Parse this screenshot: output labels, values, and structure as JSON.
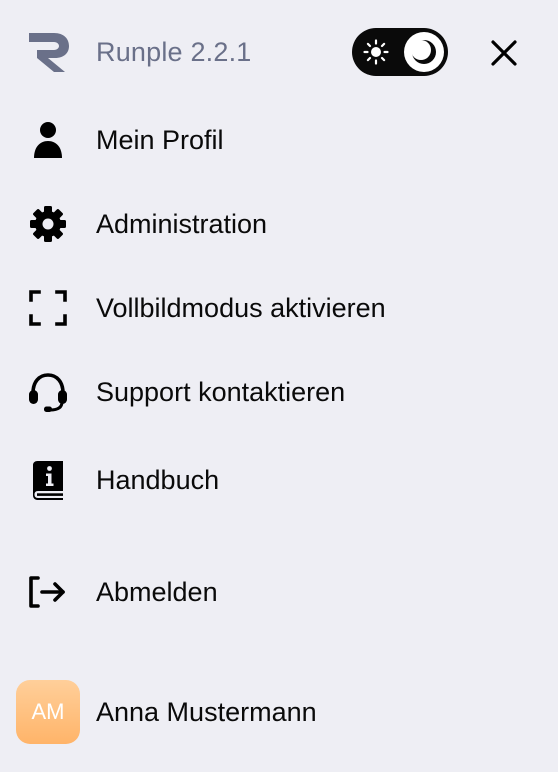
{
  "header": {
    "app_title": "Runple 2.2.1",
    "theme_toggle": {
      "light_icon": "sun-icon",
      "dark_icon": "moon-icon",
      "active": "dark"
    },
    "close_icon": "close-icon"
  },
  "menu": {
    "items": [
      {
        "label": "Mein Profil",
        "icon": "user-icon"
      },
      {
        "label": "Administration",
        "icon": "gear-icon"
      },
      {
        "label": "Vollbildmodus aktivieren",
        "icon": "fullscreen-icon"
      },
      {
        "label": "Support kontaktieren",
        "icon": "headset-icon"
      },
      {
        "label": "Handbuch",
        "icon": "manual-book-icon"
      },
      {
        "label": "Abmelden",
        "icon": "logout-icon"
      }
    ]
  },
  "user": {
    "initials": "AM",
    "name": "Anna Mustermann"
  },
  "colors": {
    "background": "#eeeef4",
    "title_text": "#6a7089",
    "toggle_bg": "#0a0a0a",
    "avatar_gradient_top": "#ffcf9a",
    "avatar_gradient_bottom": "#ffb469"
  }
}
